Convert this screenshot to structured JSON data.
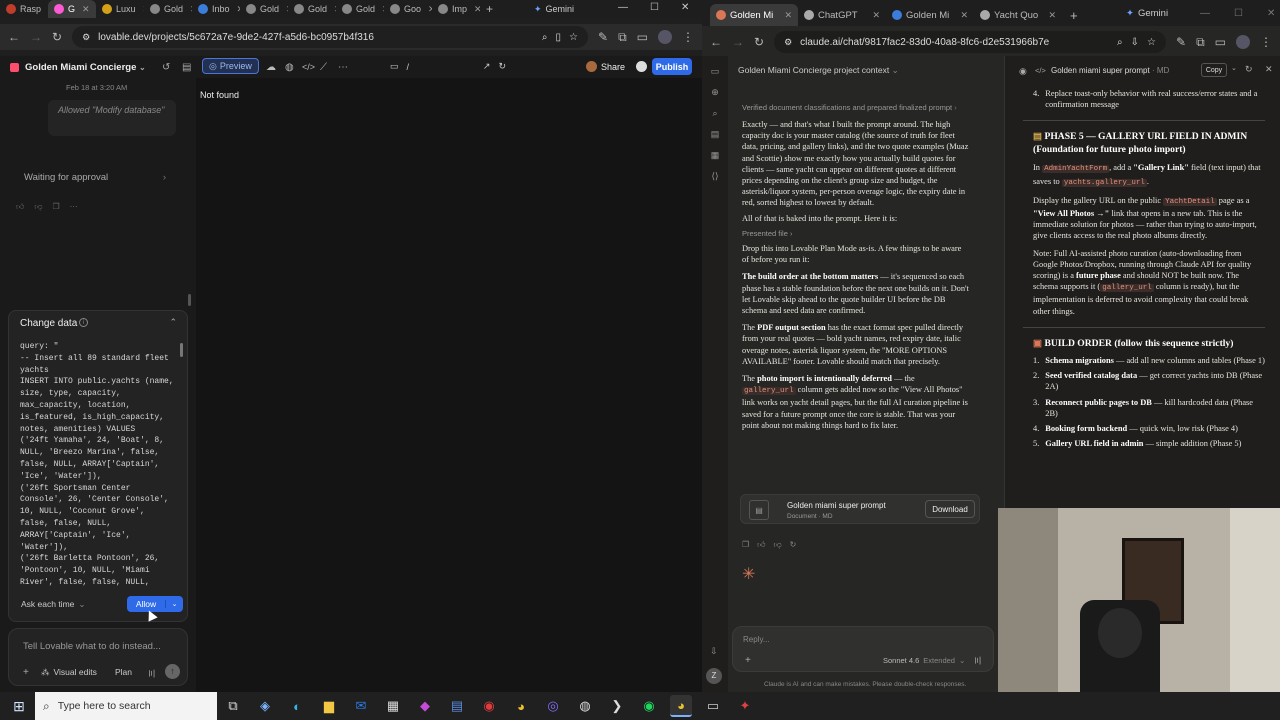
{
  "left_browser": {
    "tabs": [
      {
        "label": "Rasp",
        "color": "#c13d2b"
      },
      {
        "label": "G",
        "color": "#ff5ad6",
        "active": true
      },
      {
        "label": "Luxu",
        "color": "#d4a017"
      },
      {
        "label": "Gold",
        "color": "#888888"
      },
      {
        "label": "Inbo",
        "color": "#3c7ddc"
      },
      {
        "label": "Gold",
        "color": "#888888"
      },
      {
        "label": "Gold",
        "color": "#888888"
      },
      {
        "label": "Gold",
        "color": "#888888"
      },
      {
        "label": "Goo",
        "color": "#888888"
      },
      {
        "label": "Imp",
        "color": "#888888"
      }
    ],
    "gemini_label": "Gemini",
    "url": "lovable.dev/projects/5c672a7e-9de2-427f-a5d6-bc0957b4f316",
    "project_name": "Golden Miami Concierge",
    "preview_label": "Preview",
    "path_value": "/",
    "share_label": "Share",
    "publish_label": "Publish",
    "timestamp": "Feb 18 at 3:20 AM",
    "allowed_text": "Allowed \"Modify database\"",
    "waiting_text": "Waiting for approval",
    "not_found": "Not found",
    "change_data_title": "Change data",
    "code_lines": [
      "query: \"",
      "-- Insert all 89 standard fleet",
      "yachts",
      "INSERT INTO public.yachts (name,",
      "size, type, capacity,",
      "max_capacity, location,",
      "is_featured, is_high_capacity,",
      "notes, amenities) VALUES",
      "('24ft Yamaha', 24, 'Boat', 8,",
      "NULL, 'Breezo Marina', false,",
      "false, NULL, ARRAY['Captain',",
      "'Ice', 'Water']),",
      "('26ft Sportsman Center",
      "Console', 26, 'Center Console',",
      "10, NULL, 'Coconut Grove',",
      "false, false, NULL,",
      "ARRAY['Captain', 'Ice',",
      "'Water']),",
      "('26ft Barletta Pontoon', 26,",
      "'Pontoon', 10, NULL, 'Miami",
      "River', false, false, NULL,"
    ],
    "ask_label": "Ask each time",
    "allow_label": "Allow",
    "input_placeholder": "Tell Lovable what to do instead...",
    "visual_edits_label": "Visual edits",
    "plan_label": "Plan"
  },
  "right_browser": {
    "tabs": [
      {
        "label": "Golden Mi",
        "color": "#d97757",
        "active": true
      },
      {
        "label": "ChatGPT",
        "color": "#aaaaaa"
      },
      {
        "label": "Golden Mi",
        "color": "#3c7ddc"
      },
      {
        "label": "Yacht Quo",
        "color": "#aaaaaa"
      }
    ],
    "gemini_label": "Gemini",
    "url": "claude.ai/chat/9817fac2-83d0-40a8-8fc6-d2e531966b7e",
    "chat_title": "Golden Miami Concierge project context",
    "status_line": "Verified document classifications and prepared finalized prompt",
    "p1": "Exactly — and that's what I built the prompt around. The high capacity doc is your master catalog (the source of truth for fleet data, pricing, and gallery links), and the two quote examples (Muaz and Scottie) show me exactly how you actually build quotes for clients — same yacht can appear on different quotes at different prices depending on the client's group size and budget, the asterisk/liquor system, per-person overage logic, the expiry date in red, sorted highest to lowest by default.",
    "p2": "All of that is baked into the prompt. Here it is:",
    "presented_file": "Presented file",
    "p3": "Drop this into Lovable Plan Mode as-is. A few things to be aware of before you run it:",
    "p4_bold": "The build order at the bottom matters",
    "p4_rest": " — it's sequenced so each phase has a stable foundation before the next one builds on it. Don't let Lovable skip ahead to the quote builder UI before the DB schema and seed data are confirmed.",
    "p5_pre": "The ",
    "p5_bold": "PDF output section",
    "p5_rest": " has the exact format spec pulled directly from your real quotes — bold yacht names, red expiry date, italic overage notes, asterisk liquor system, the \"MORE OPTIONS AVAILABLE\" footer. Lovable should match that precisely.",
    "p6_pre": "The ",
    "p6_bold": "photo import is intentionally deferred",
    "p6_code": "gallery_url",
    "p6_a": " — the ",
    "p6_rest": " column gets added now so the \"View All Photos\" link works on yacht detail pages, but the full AI curation pipeline is saved for a future prompt once the core is stable. That was your point about not making things hard to fix later.",
    "file_name": "Golden miami super prompt",
    "file_type": "Document · MD",
    "download_label": "Download",
    "reply_placeholder": "Reply...",
    "model_label": "Sonnet 4.6",
    "mode_label": "Extended",
    "disclaimer": "Claude is AI and can make mistakes. Please double-check responses.",
    "doc_title": "Golden miami super prompt",
    "doc_ext": "· MD",
    "copy_label": "Copy",
    "doc": {
      "item4_num": "4.",
      "item4": "Replace toast-only behavior with real success/error states and a confirmation message",
      "phase5_title": "PHASE 5 — GALLERY URL FIELD IN ADMIN (Foundation for future photo import)",
      "phase5_p1_a": "In ",
      "phase5_code1": "AdminYachtForm",
      "phase5_p1_b": ", add a ",
      "phase5_p1_bold": "\"Gallery Link\"",
      "phase5_p1_c": " field (text input) that saves to ",
      "phase5_code2": "yachts.gallery_url",
      "phase5_p1_d": ".",
      "phase5_p2_a": "Display the gallery URL on the public ",
      "phase5_code3": "YachtDetail",
      "phase5_p2_b": " page as a ",
      "phase5_p2_bold": "\"View All Photos →\"",
      "phase5_p2_c": " link that opens in a new tab. This is the immediate solution for photos — rather than trying to auto-import, give clients access to the real photo albums directly.",
      "phase5_p3_a": "Note: Full AI-assisted photo curation (auto-downloading from Google Photos/Dropbox, running through Claude API for quality scoring) is a ",
      "phase5_p3_bold": "future phase",
      "phase5_p3_b": " and should NOT be built now. The schema supports it (",
      "phase5_code4": "gallery_url",
      "phase5_p3_c": " column is ready), but the implementation is deferred to avoid complexity that could break other things.",
      "build_title": "BUILD ORDER (follow this sequence strictly)",
      "build_items": [
        {
          "n": "1.",
          "b": "Schema migrations",
          "t": " — add all new columns and tables (Phase 1)"
        },
        {
          "n": "2.",
          "b": "Seed verified catalog data",
          "t": " — get correct yachts into DB (Phase 2A)"
        },
        {
          "n": "3.",
          "b": "Reconnect public pages to DB",
          "t": " — kill hardcoded data (Phase 2B)"
        },
        {
          "n": "4.",
          "b": "Booking form backend",
          "t": " — quick win, low risk (Phase 4)"
        },
        {
          "n": "5.",
          "b": "Gallery URL field in admin",
          "t": " — simple addition (Phase 5)"
        }
      ]
    }
  },
  "taskbar": {
    "search_placeholder": "Type here to search"
  }
}
